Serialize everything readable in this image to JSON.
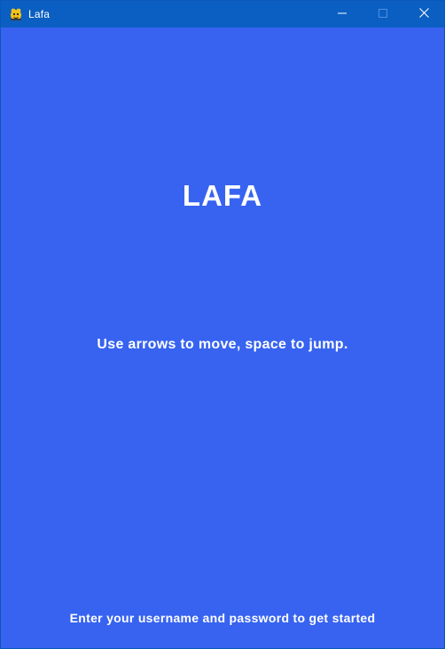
{
  "window": {
    "title": "Lafa",
    "icon": "pygame-snake-icon",
    "controls": {
      "minimize_icon": "minimize-icon",
      "maximize_icon": "maximize-icon",
      "close_icon": "close-icon"
    }
  },
  "screen": {
    "game_title": "LAFA",
    "instructions": "Use arrows to move, space to jump.",
    "prompt": "Enter your username and password to get started"
  },
  "colors": {
    "titlebar": "#0b5fc2",
    "background": "#3763f0",
    "text": "#ffffff"
  }
}
